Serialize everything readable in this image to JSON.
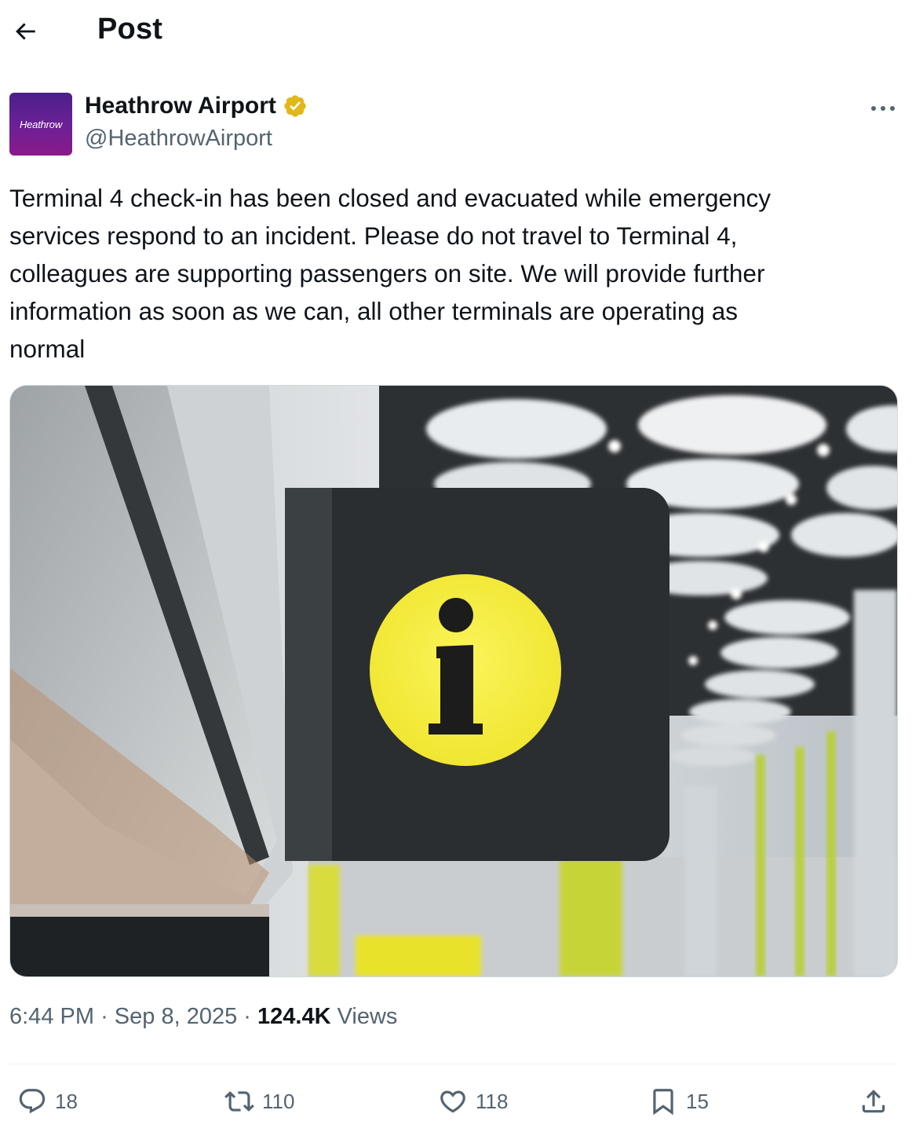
{
  "header": {
    "title": "Post",
    "back_icon": "arrow-left-icon"
  },
  "author": {
    "name": "Heathrow Airport",
    "handle": "@HeathrowAirport",
    "avatar_text": "Heathrow",
    "verified_icon": "verified-badge-icon",
    "verified_color": "#e2b719",
    "avatar_colors": [
      "#4b1f8a",
      "#8a1a8a"
    ]
  },
  "post": {
    "text": "Terminal 4 check-in has been closed and evacuated while emergency\nservices respond to an incident. Please do not travel to Terminal 4,\ncolleagues are supporting passengers on site. We will provide further\ninformation as soon as we can, all other terminals are operating as\nnormal",
    "media_icon": "information-sign-photo"
  },
  "meta": {
    "time": "6:44 PM",
    "date": "Sep 8, 2025",
    "views_count": "124.4K",
    "views_label": "Views",
    "separator": "·"
  },
  "actions": {
    "reply": {
      "icon": "reply-icon",
      "count": "18"
    },
    "repost": {
      "icon": "repost-icon",
      "count": "110"
    },
    "like": {
      "icon": "heart-icon",
      "count": "118"
    },
    "bookmark": {
      "icon": "bookmark-icon",
      "count": "15"
    },
    "share": {
      "icon": "share-icon"
    }
  },
  "colors": {
    "text": "#0f1419",
    "secondary": "#536471",
    "sign_yellow": "#f2ea3a"
  }
}
